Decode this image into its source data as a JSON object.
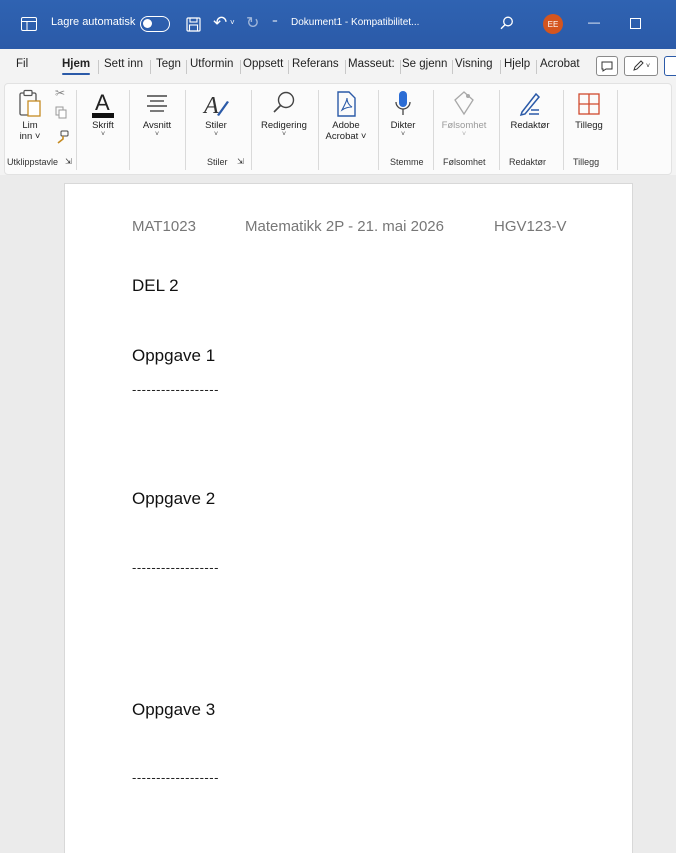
{
  "titlebar": {
    "autosave_label": "Lagre automatisk",
    "doc_title": "Dokument1  -  Kompatibilitet...",
    "avatar_initials": "EE",
    "minimize": "—"
  },
  "tabs": [
    {
      "label": "Fil"
    },
    {
      "label": "Hjem"
    },
    {
      "label": "Sett inn"
    },
    {
      "label": "Tegn"
    },
    {
      "label": "Utformin"
    },
    {
      "label": "Oppsett"
    },
    {
      "label": "Referans"
    },
    {
      "label": "Masseut:"
    },
    {
      "label": "Se gjenn"
    },
    {
      "label": "Visning"
    },
    {
      "label": "Hjelp"
    },
    {
      "label": "Acrobat"
    }
  ],
  "ribbon": {
    "paste": {
      "line1": "Lim",
      "line2": "inn ˅"
    },
    "font": "Skrift",
    "paragraph": "Avsnitt",
    "styles": "Stiler",
    "editing": "Redigering",
    "adobe": {
      "line1": "Adobe",
      "line2": "Acrobat ˅"
    },
    "dictate": "Dikter",
    "sensitivity": "Følsomhet",
    "editor": "Redaktør",
    "addins": "Tillegg",
    "groups": {
      "clipboard": "Utklippstavle",
      "styles": "Stiler",
      "voice": "Stemme",
      "sensitivity": "Følsomhet",
      "editor": "Redaktør",
      "addins": "Tillegg"
    }
  },
  "document": {
    "header": {
      "left": "MAT1023",
      "center": "Matematikk 2P - 21. mai 2026",
      "right": "HGV123-V"
    },
    "part": "DEL 2",
    "tasks": [
      {
        "title": "Oppgave 1",
        "line": "------------------"
      },
      {
        "title": "Oppgave 2",
        "line": "------------------"
      },
      {
        "title": "Oppgave 3",
        "line": "------------------"
      }
    ]
  }
}
